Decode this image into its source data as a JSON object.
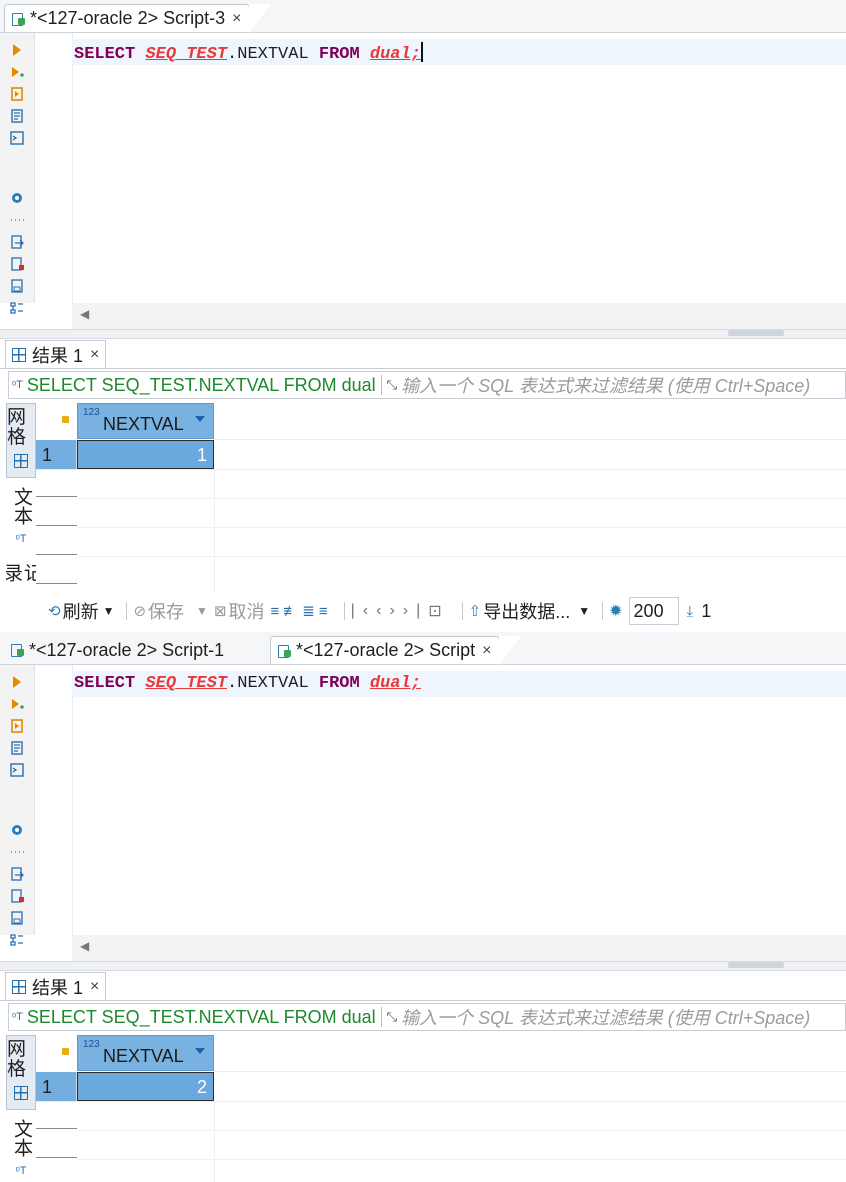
{
  "panel_top": {
    "tabs": [
      {
        "label": "*<127-oracle 2> Script-3",
        "active": true,
        "closable": true
      }
    ],
    "editor": {
      "tokens": [
        {
          "text": "SELECT",
          "kind": "keyword"
        },
        {
          "text": " ",
          "kind": "plain"
        },
        {
          "text": "SEQ_TEST",
          "kind": "identifier"
        },
        {
          "text": ".NEXTVAL ",
          "kind": "plain"
        },
        {
          "text": "FROM",
          "kind": "keyword"
        },
        {
          "text": " ",
          "kind": "plain"
        },
        {
          "text": "dual;",
          "kind": "identifier"
        }
      ]
    },
    "results": {
      "tab_label": "结果 1",
      "filter_sql": "SELECT SEQ_TEST.NEXTVAL FROM dual",
      "filter_placeholder": "输入一个 SQL 表达式来过滤结果 (使用 Ctrl+Space)",
      "side_tabs": [
        "网格",
        "文本",
        "记录"
      ],
      "column": {
        "type_hint": "123",
        "name": "NEXTVAL"
      },
      "rows": [
        {
          "num": "1",
          "value": "1"
        }
      ]
    },
    "toolbar": {
      "refresh": "刷新",
      "save": "保存",
      "cancel": "取消",
      "export": "导出数据...",
      "fetch_size": "200",
      "row_count": "1"
    }
  },
  "panel_bottom": {
    "tabs": [
      {
        "label": "*<127-oracle 2> Script-1",
        "active": false,
        "closable": false
      },
      {
        "label": "*<127-oracle 2> Script",
        "active": true,
        "closable": true
      }
    ],
    "editor": {
      "tokens": [
        {
          "text": "SELECT",
          "kind": "keyword"
        },
        {
          "text": " ",
          "kind": "plain"
        },
        {
          "text": "SEQ_TEST",
          "kind": "identifier"
        },
        {
          "text": ".NEXTVAL ",
          "kind": "plain"
        },
        {
          "text": "FROM",
          "kind": "keyword"
        },
        {
          "text": " ",
          "kind": "plain"
        },
        {
          "text": "dual;",
          "kind": "identifier"
        }
      ]
    },
    "results": {
      "tab_label": "结果 1",
      "filter_sql": "SELECT SEQ_TEST.NEXTVAL FROM dual",
      "filter_placeholder": "输入一个 SQL 表达式来过滤结果 (使用 Ctrl+Space)",
      "side_tabs": [
        "网格",
        "文本"
      ],
      "column": {
        "type_hint": "123",
        "name": "NEXTVAL"
      },
      "rows": [
        {
          "num": "1",
          "value": "2"
        }
      ]
    }
  },
  "colors": {
    "keyword": "#7f0055",
    "identifier": "#e8393b",
    "filter_sql": "#1b8a2c",
    "selection": "#6aa8de",
    "header": "#79b2e0"
  },
  "icons": {
    "left_toolbar": [
      "execute-statement-icon",
      "execute-in-new-tab-icon",
      "execute-script-icon",
      "explain-plan-icon",
      "open-console-icon",
      "settings-icon",
      "more-icon",
      "export-icon",
      "load-file-icon",
      "save-file-icon",
      "format-icon"
    ]
  }
}
